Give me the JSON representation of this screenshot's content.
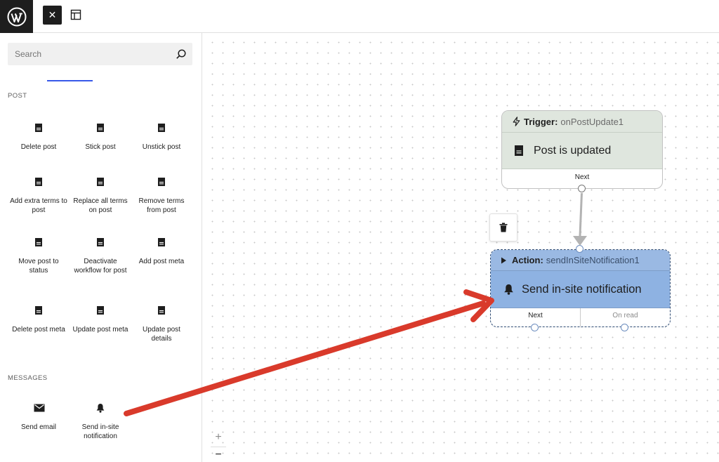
{
  "topbar": {
    "logo_icon": "wordpress-logo",
    "close_icon": "close-icon",
    "layout_icon": "layout-icon"
  },
  "sidebar": {
    "search": {
      "placeholder": "Search",
      "icon": "search-icon"
    },
    "sections": [
      {
        "label": "POST",
        "items": [
          {
            "label": "Delete post",
            "icon": "post-icon"
          },
          {
            "label": "Stick post",
            "icon": "post-icon"
          },
          {
            "label": "Unstick post",
            "icon": "post-icon"
          },
          {
            "label": "Add extra terms to post",
            "icon": "post-icon"
          },
          {
            "label": "Replace all terms on post",
            "icon": "post-icon"
          },
          {
            "label": "Remove terms from post",
            "icon": "post-icon"
          },
          {
            "label": "Move post to status",
            "icon": "post-icon"
          },
          {
            "label": "Deactivate workflow for post",
            "icon": "post-icon"
          },
          {
            "label": "Add post meta",
            "icon": "post-icon"
          },
          {
            "label": "Delete post meta",
            "icon": "post-icon"
          },
          {
            "label": "Update post meta",
            "icon": "post-icon"
          },
          {
            "label": "Update post details",
            "icon": "post-icon"
          }
        ]
      },
      {
        "label": "MESSAGES",
        "items": [
          {
            "label": "Send email",
            "icon": "email-icon"
          },
          {
            "label": "Send in-site notification",
            "icon": "bell-icon"
          }
        ]
      }
    ]
  },
  "canvas": {
    "zoom_in": "+",
    "zoom_out": "−",
    "trigger_node": {
      "kind_label": "Trigger:",
      "id": "onPostUpdate1",
      "title": "Post is updated",
      "output": "Next",
      "icon": "post-icon",
      "kind_icon": "lightning-icon",
      "color": "#dfe6de"
    },
    "action_node": {
      "kind_label": "Action:",
      "id": "sendInSiteNotification1",
      "title": "Send in-site notification",
      "outputs": [
        "Next",
        "On read"
      ],
      "icon": "bell-icon",
      "kind_icon": "play-icon",
      "color": "#8eb2e2"
    },
    "delete_icon": "trash-icon",
    "annotation_arrow_color": "#d93a2b"
  }
}
